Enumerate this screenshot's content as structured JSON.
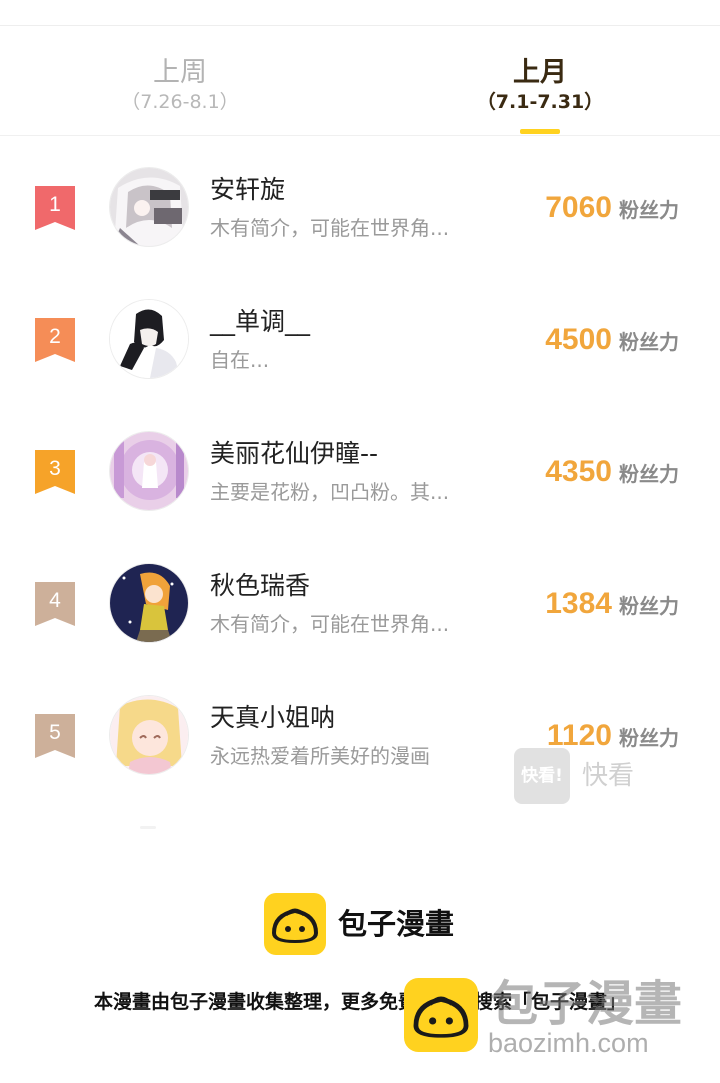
{
  "tabs": [
    {
      "title": "上周",
      "range": "（7.26-8.1）",
      "active": false
    },
    {
      "title": "上月",
      "range": "（7.1-7.31）",
      "active": true
    }
  ],
  "fans_unit": "粉丝力",
  "colors": {
    "active_indicator": "#ffd21f",
    "fans_value": "#f1a63c",
    "rank_1": "#f0696b",
    "rank_2": "#f58d57",
    "rank_3": "#f6a329",
    "rank_other": "#cdb09a"
  },
  "ranking": [
    {
      "rank": "1",
      "name": "安轩旋",
      "desc": "木有简介，可能在世界角...",
      "fans": "7060"
    },
    {
      "rank": "2",
      "name": "__单调__",
      "desc": "自在...",
      "fans": "4500"
    },
    {
      "rank": "3",
      "name": "美丽花仙伊瞳--",
      "desc": "主要是花粉，凹凸粉。其...",
      "fans": "4350"
    },
    {
      "rank": "4",
      "name": "秋色瑞香",
      "desc": "木有简介，可能在世界角...",
      "fans": "1384"
    },
    {
      "rank": "5",
      "name": "天真小姐呐",
      "desc": "永远热爱着所美好的漫画",
      "fans": "1120"
    }
  ],
  "kuaikan_watermark": {
    "logo_text": "快看!",
    "text": "快看"
  },
  "footer": {
    "brand": "包子漫畫",
    "notice": "本漫畫由包子漫畫收集整理，更多免費漫畫請搜索「包子漫畫」",
    "watermark_title": "包子漫畫",
    "watermark_url": "baozimh.com"
  }
}
